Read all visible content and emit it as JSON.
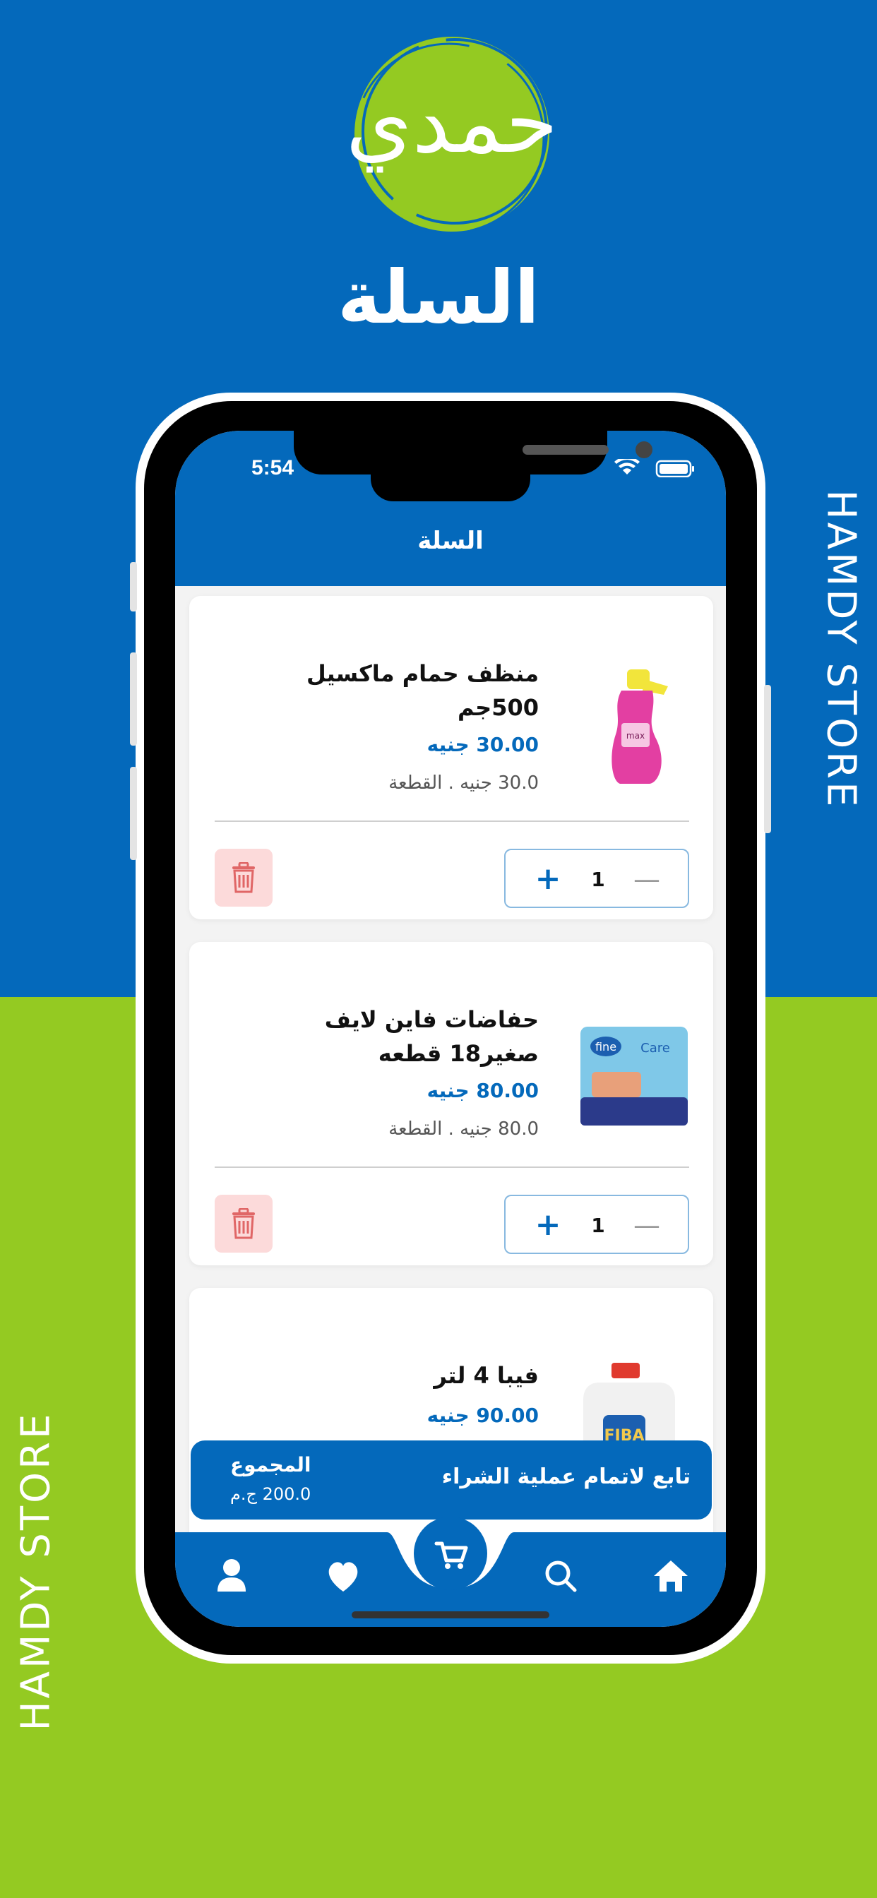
{
  "brand": {
    "logo_text": "حمدي",
    "side_text_right": "HAMDY STORE",
    "side_text_left": "HAMDY STORE"
  },
  "promo": {
    "title": "السلة"
  },
  "colors": {
    "primary": "#0469BB",
    "accent": "#94CA22",
    "trash_bg": "#FCDADA",
    "trash_icon": "#E06666"
  },
  "status_bar": {
    "time": "5:54"
  },
  "header": {
    "title": "السلة"
  },
  "cart": {
    "items": [
      {
        "name": "منظف حمام ماكسيل 500جم",
        "price": "30.00 جنيه",
        "unit_price": "30.0 جنيه . القطعة",
        "quantity": "1",
        "image": "pink-cleaner-bottle"
      },
      {
        "name": "حفاضات فاين لايف صغير18 قطعه",
        "price": "80.00 جنيه",
        "unit_price": "80.0 جنيه . القطعة",
        "quantity": "1",
        "image": "fine-diapers-pack"
      },
      {
        "name": "فيبا 4 لتر",
        "price": "90.00 جنيه",
        "image": "fiba-detergent-bottle"
      }
    ]
  },
  "checkout": {
    "action": "تابع لاتمام عملية الشراء",
    "total_label": "المجموع",
    "total_value": "200.0 ج.م"
  },
  "nav": {
    "items": [
      "profile-icon",
      "heart-icon",
      "cart-icon",
      "search-icon",
      "home-icon"
    ]
  }
}
